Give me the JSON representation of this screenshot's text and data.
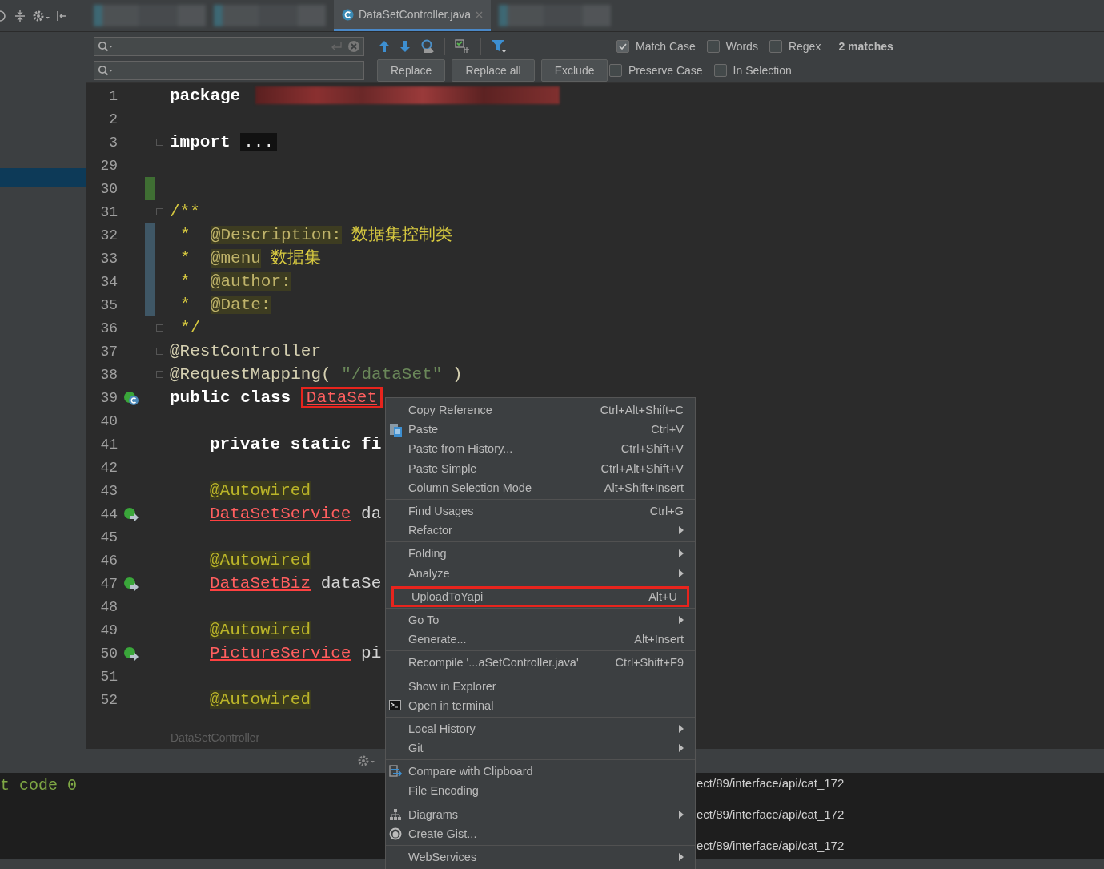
{
  "tabs": [
    {
      "kind": "blurred",
      "selected": false
    },
    {
      "kind": "blurred",
      "selected": false
    },
    {
      "kind": "file",
      "label": "DataSetController.java",
      "selected": true
    },
    {
      "kind": "blurred",
      "selected": false
    }
  ],
  "find": {
    "options": [
      {
        "label": "Match Case",
        "checked": true
      },
      {
        "label": "Words",
        "checked": false
      },
      {
        "label": "Regex",
        "checked": false
      }
    ],
    "matches": "2 matches"
  },
  "replace": {
    "buttons": [
      "Replace",
      "Replace all",
      "Exclude"
    ],
    "options": [
      {
        "label": "Preserve Case",
        "checked": false
      },
      {
        "label": "In Selection",
        "checked": false
      }
    ]
  },
  "editor": {
    "lines": [
      {
        "number": "1",
        "fold": false,
        "kind": "top",
        "tokens": [
          {
            "kind": "kw",
            "text": "package"
          },
          {
            "kind": "redacted"
          }
        ]
      },
      {
        "number": "2",
        "fold": false
      },
      {
        "number": "3",
        "fold": true,
        "kind": "top",
        "tokens": [
          {
            "kind": "kw",
            "text": "import"
          },
          {
            "kind": "folded",
            "text": "..."
          }
        ]
      },
      {
        "number": "29",
        "fold": false
      },
      {
        "number": "30",
        "fold": false,
        "change": {
          "kind": "added"
        }
      },
      {
        "number": "31",
        "fold": true,
        "kind": "top",
        "tokens": [
          {
            "kind": "doc",
            "text": "/**"
          }
        ]
      },
      {
        "number": "32",
        "fold": false,
        "kind": "doc",
        "change": {
          "kind": "modified"
        },
        "tokens": [
          {
            "kind": "doc",
            "text": "*"
          },
          {
            "kind": "doctag",
            "text": "@Description:"
          },
          {
            "kind": "doc",
            "text": "数据集控制类"
          }
        ]
      },
      {
        "number": "33",
        "fold": false,
        "kind": "doc",
        "change": {
          "kind": "modified"
        },
        "tokens": [
          {
            "kind": "doc",
            "text": "*"
          },
          {
            "kind": "doctag",
            "text": "@menu"
          },
          {
            "kind": "doc",
            "text": "数据集"
          }
        ]
      },
      {
        "number": "34",
        "fold": false,
        "kind": "doc",
        "change": {
          "kind": "modified"
        },
        "tokens": [
          {
            "kind": "doc",
            "text": "*"
          },
          {
            "kind": "doctag",
            "text": "@author:"
          }
        ]
      },
      {
        "number": "35",
        "fold": false,
        "kind": "doc",
        "change": {
          "kind": "modified"
        },
        "tokens": [
          {
            "kind": "doc",
            "text": "*"
          },
          {
            "kind": "doctag",
            "text": "@Date:"
          }
        ]
      },
      {
        "number": "36",
        "fold": true,
        "kind": "doc",
        "tokens": [
          {
            "kind": "doc",
            "text": "*/"
          }
        ]
      },
      {
        "number": "37",
        "fold": true,
        "kind": "top",
        "tokens": [
          {
            "kind": "anno",
            "text": "@RestController"
          }
        ]
      },
      {
        "number": "38",
        "fold": true,
        "kind": "top",
        "tokens": [
          {
            "kind": "anno",
            "text": "@RequestMapping("
          },
          {
            "kind": "str",
            "text": "\"/dataSet\""
          },
          {
            "kind": "anno",
            "text": ")"
          }
        ]
      },
      {
        "number": "39",
        "fold": false,
        "kind": "top",
        "gutter": {
          "kind": "class"
        },
        "tokens": [
          {
            "kind": "kw",
            "text": "public class"
          },
          {
            "kind": "err",
            "text": "DataSet",
            "framed": true
          }
        ]
      },
      {
        "number": "40",
        "fold": false
      },
      {
        "number": "41",
        "fold": false,
        "kind": "member",
        "tokens": [
          {
            "kind": "kw",
            "text": "private static fi"
          }
        ]
      },
      {
        "number": "42",
        "fold": false
      },
      {
        "number": "43",
        "fold": false,
        "kind": "member",
        "tokens": [
          {
            "kind": "annobg",
            "text": "@Autowired"
          }
        ]
      },
      {
        "number": "44",
        "fold": false,
        "kind": "member",
        "gutter": {
          "kind": "bean"
        },
        "tokens": [
          {
            "kind": "err",
            "text": "DataSetService"
          },
          {
            "kind": "plain",
            "text": "da"
          }
        ]
      },
      {
        "number": "45",
        "fold": false
      },
      {
        "number": "46",
        "fold": false,
        "kind": "member",
        "tokens": [
          {
            "kind": "annobg",
            "text": "@Autowired"
          }
        ]
      },
      {
        "number": "47",
        "fold": false,
        "kind": "member",
        "gutter": {
          "kind": "bean"
        },
        "tokens": [
          {
            "kind": "err",
            "text": "DataSetBiz"
          },
          {
            "kind": "plain",
            "text": "dataSe"
          }
        ]
      },
      {
        "number": "48",
        "fold": false
      },
      {
        "number": "49",
        "fold": false,
        "kind": "member",
        "tokens": [
          {
            "kind": "annobg",
            "text": "@Autowired"
          }
        ]
      },
      {
        "number": "50",
        "fold": false,
        "kind": "member",
        "gutter": {
          "kind": "bean"
        },
        "tokens": [
          {
            "kind": "err",
            "text": "PictureService"
          },
          {
            "kind": "plain",
            "text": "pi"
          }
        ]
      },
      {
        "number": "51",
        "fold": false
      },
      {
        "number": "52",
        "fold": false,
        "kind": "member",
        "tokens": [
          {
            "kind": "annobg",
            "text": "@Autowired"
          }
        ]
      }
    ]
  },
  "breadcrumb": "DataSetController",
  "console": {
    "left": [
      "t code 0"
    ],
    "right": [
      "ect/89/interface/api/cat_172",
      "ect/89/interface/api/cat_172",
      "ect/89/interface/api/cat_172"
    ]
  },
  "menu": {
    "groups": [
      {
        "items": [
          {
            "label": "Copy Reference",
            "shortcut": "Ctrl+Alt+Shift+C",
            "submenu": false,
            "marked": false
          },
          {
            "label": "Paste",
            "shortcut": "Ctrl+V",
            "kind": "paste",
            "submenu": false,
            "marked": false
          },
          {
            "label": "Paste from History...",
            "shortcut": "Ctrl+Shift+V",
            "submenu": false,
            "marked": false
          },
          {
            "label": "Paste Simple",
            "shortcut": "Ctrl+Alt+Shift+V",
            "submenu": false,
            "marked": false
          },
          {
            "label": "Column Selection Mode",
            "shortcut": "Alt+Shift+Insert",
            "submenu": false,
            "marked": false
          }
        ]
      },
      {
        "items": [
          {
            "label": "Find Usages",
            "shortcut": "Ctrl+G",
            "submenu": false,
            "marked": false
          },
          {
            "label": "Refactor",
            "submenu": true,
            "marked": false
          }
        ]
      },
      {
        "items": [
          {
            "label": "Folding",
            "submenu": true,
            "marked": false
          },
          {
            "label": "Analyze",
            "submenu": true,
            "marked": false
          }
        ]
      },
      {
        "items": [
          {
            "label": "UploadToYapi",
            "shortcut": "Alt+U",
            "submenu": false,
            "marked": true
          }
        ]
      },
      {
        "items": [
          {
            "label": "Go To",
            "submenu": true,
            "marked": false
          },
          {
            "label": "Generate...",
            "shortcut": "Alt+Insert",
            "submenu": false,
            "marked": false
          }
        ]
      },
      {
        "items": [
          {
            "label": "Recompile '...aSetController.java'",
            "shortcut": "Ctrl+Shift+F9",
            "submenu": false,
            "marked": false
          }
        ]
      },
      {
        "items": [
          {
            "label": "Show in Explorer",
            "submenu": false,
            "marked": false
          },
          {
            "label": "Open in terminal",
            "kind": "terminal",
            "submenu": false,
            "marked": false
          }
        ]
      },
      {
        "items": [
          {
            "label": "Local History",
            "submenu": true,
            "marked": false
          },
          {
            "label": "Git",
            "submenu": true,
            "marked": false
          }
        ]
      },
      {
        "items": [
          {
            "label": "Compare with Clipboard",
            "kind": "compare",
            "submenu": false,
            "marked": false
          },
          {
            "label": "File Encoding",
            "submenu": false,
            "marked": false
          }
        ]
      },
      {
        "items": [
          {
            "label": "Diagrams",
            "kind": "diagram",
            "submenu": true,
            "marked": false
          },
          {
            "label": "Create Gist...",
            "kind": "gist",
            "submenu": false,
            "marked": false
          }
        ]
      },
      {
        "items": [
          {
            "label": "WebServices",
            "submenu": true,
            "marked": false
          }
        ]
      }
    ]
  }
}
